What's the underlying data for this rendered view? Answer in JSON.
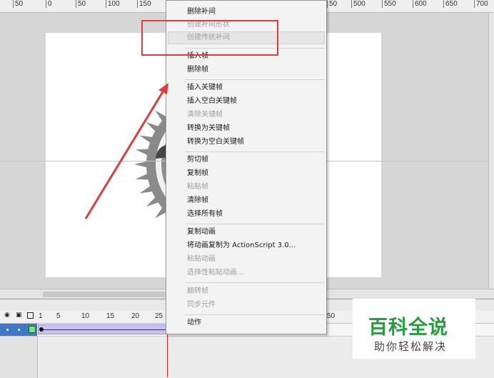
{
  "ruler": {
    "ticks": [
      "50",
      "0",
      "50",
      "100",
      "150",
      "50",
      "500",
      "550",
      "600",
      "650",
      "700"
    ]
  },
  "timeline": {
    "frame_numbers": [
      "1",
      "5",
      "10",
      "15",
      "20",
      "25",
      "50"
    ]
  },
  "context_menu": {
    "items": [
      {
        "label": "删除补间",
        "enabled": true
      },
      {
        "label": "创建补间形状",
        "enabled": false
      },
      {
        "label": "创建传统补间",
        "enabled": false
      },
      {
        "label": "插入帧",
        "enabled": true
      },
      {
        "label": "删除帧",
        "enabled": true
      },
      {
        "label": "插入关键帧",
        "enabled": true
      },
      {
        "label": "插入空白关键帧",
        "enabled": true
      },
      {
        "label": "清除关键帧",
        "enabled": false
      },
      {
        "label": "转换为关键帧",
        "enabled": true
      },
      {
        "label": "转换为空白关键帧",
        "enabled": true
      },
      {
        "label": "剪切帧",
        "enabled": true
      },
      {
        "label": "复制帧",
        "enabled": true
      },
      {
        "label": "粘贴帧",
        "enabled": false
      },
      {
        "label": "清除帧",
        "enabled": true
      },
      {
        "label": "选择所有帧",
        "enabled": true
      },
      {
        "label": "复制动画",
        "enabled": true
      },
      {
        "label": "将动画复制为 ActionScript 3.0...",
        "enabled": true
      },
      {
        "label": "粘贴动画",
        "enabled": false
      },
      {
        "label": "选择性粘贴动画...",
        "enabled": false
      },
      {
        "label": "翻转帧",
        "enabled": false
      },
      {
        "label": "同步元件",
        "enabled": false
      },
      {
        "label": "动作",
        "enabled": true
      }
    ]
  },
  "watermark": {
    "title": "百科全说",
    "subtitle": "助你轻松解决"
  },
  "colors": {
    "highlight_box": "#e23b3b",
    "tween_span": "#c9c2ef",
    "playhead": "#e02020",
    "watermark_green": "#22a03c"
  }
}
